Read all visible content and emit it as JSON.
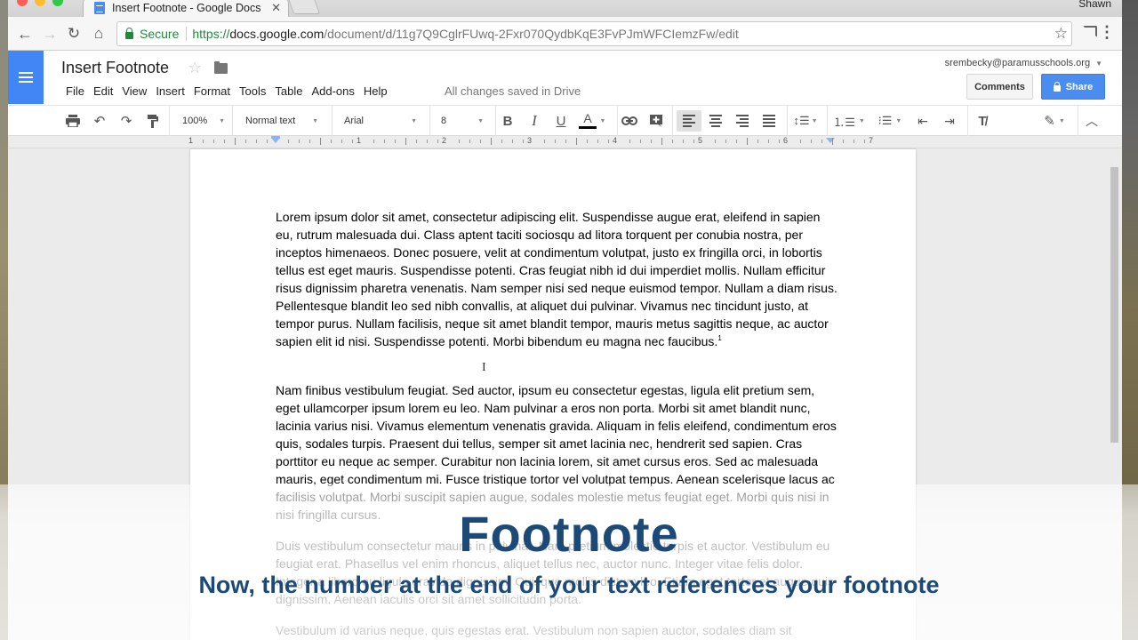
{
  "browser": {
    "tab_title": "Insert Footnote - Google Docs",
    "profile_name": "Shawn",
    "secure_label": "Secure",
    "url_scheme": "https://",
    "url_host": "docs.google.com",
    "url_path": "/document/d/11g7Q9CglrFUwq-2Fxr070QydbKqE3FvPJmWFCIemzFw/edit"
  },
  "docs": {
    "title": "Insert Footnote",
    "menu": [
      "File",
      "Edit",
      "View",
      "Insert",
      "Format",
      "Tools",
      "Table",
      "Add-ons",
      "Help"
    ],
    "save_status": "All changes saved in Drive",
    "account": "srembecky@paramusschools.org",
    "comments_label": "Comments",
    "share_label": "Share",
    "brand_color": "#4285f4"
  },
  "toolbar": {
    "zoom": "100%",
    "style": "Normal text",
    "font": "Arial",
    "size": "8",
    "bold": "B",
    "italic": "I",
    "underline": "U",
    "text_color": "A",
    "active_alignment": "left"
  },
  "ruler": {
    "labels": [
      "1",
      "1",
      "2",
      "3",
      "4",
      "5",
      "6",
      "7"
    ]
  },
  "document": {
    "paragraphs": [
      {
        "text": "Lorem ipsum dolor sit amet, consectetur adipiscing elit. Suspendisse augue erat, eleifend in sapien eu, rutrum malesuada dui. Class aptent taciti sociosqu ad litora torquent per conubia nostra, per inceptos himenaeos. Donec posuere, velit at condimentum volutpat, justo ex fringilla orci, in lobortis tellus est eget mauris. Suspendisse potenti. Cras feugiat nibh id dui imperdiet mollis. Nullam efficitur risus dignissim pharetra venenatis. Nam semper nisi sed neque euismod tempor. Nullam a diam risus. Pellentesque blandit leo sed nibh convallis, at aliquet dui pulvinar. Vivamus nec tincidunt justo, at tempor purus. Nullam facilisis, neque sit amet blandit tempor, mauris metus sagittis neque, ac auctor sapien elit id nisi. Suspendisse potenti. Morbi bibendum eu magna nec faucibus.",
        "footnote_ref": "1"
      },
      {
        "text": "Nam finibus vestibulum feugiat. Sed auctor, ipsum eu consectetur egestas, ligula elit pretium sem, eget ullamcorper ipsum lorem eu leo. Nam pulvinar a eros non porta. Morbi sit amet blandit nunc, lacinia varius nisi. Vivamus elementum venenatis gravida. Aliquam in felis eleifend, condimentum eros quis, sodales turpis. Praesent dui tellus, semper sit amet lacinia nec, hendrerit sed sapien. Cras porttitor eu neque ac semper. Curabitur non lacinia lorem, sit amet cursus eros. Sed ac malesuada mauris, eget condimentum mi. Fusce tristique tortor vel volutpat tempus. Aenean scelerisque lacus ac facilisis volutpat. Morbi suscipit sapien augue, sodales molestie metus feugiat eget. Morbi quis nisi in nisi fringilla cursus."
      },
      {
        "text": "Duis vestibulum consectetur mauris in pulvinar. Nam pretium molestie turpis et auctor. Vestibulum eu feugiat erat. Phasellus vel enim rhoncus, aliquet tellus nec, auctor nunc. Integer vitae felis dolor. Integer a libero eu ligula gravida dignissim. Quisque mollis dictum leo. Etiam eget tortor et augue quis dignissim. Aenean iaculis orci sit amet sollicitudin porta."
      },
      {
        "text": "Vestibulum id varius neque, quis egestas erat. Vestibulum non sapien auctor, sodales diam sit"
      }
    ]
  },
  "overlay": {
    "title": "Footnote",
    "subtitle": "Now, the number at the end of your text references your footnote",
    "color": "#1c4a78"
  }
}
